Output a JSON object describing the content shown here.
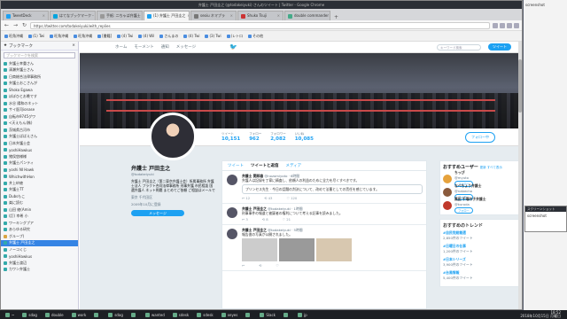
{
  "window": {
    "title": "弁護士 戸田圭之 (@todakeiyuki) さんのツイート | Twitter - Google Chrome"
  },
  "tabs": [
    {
      "label": "TweetDeck",
      "color": "#1da1f2"
    },
    {
      "label": "はてなブックマーク - Ninja",
      "color": "#00a4de"
    },
    {
      "label": "手紙: 二ちゃば弁護士",
      "color": "#999"
    },
    {
      "label": "(1) 弁護士 戸田圭之",
      "color": "#1da1f2",
      "active": true
    },
    {
      "label": "seoiu ネマプラ",
      "color": "#777"
    },
    {
      "label": "Shuko Tsuji",
      "color": "#c33"
    },
    {
      "label": "double commander",
      "color": "#4a8"
    }
  ],
  "bookmarks": [
    "旺角沖縄",
    "(1) Twi",
    "旺角沖縄",
    "旺角沖縄",
    "[書籍]",
    "(4) Twi",
    "(4) Wil",
    "さんまの",
    "(4) Twi",
    "(3) Twi",
    "(レトロ",
    "その他"
  ],
  "address": {
    "url": "https://twitter.com/todakeiyuki/with_replies"
  },
  "sidebar": {
    "title": "ブックマーク",
    "search_placeholder": "ブックマークを検索",
    "items": [
      "弁護士幸重さん",
      "清瀬弁護士さん",
      "日商総合法律事務所",
      "弁護士おこさんが",
      "Shoko Egawa",
      "ぼぼひとお晩です",
      "水谷 陽和のネット",
      "サイ医司ionase",
      "自転市9745グワ",
      "<天えもん(株)",
      "茨城県古河市",
      "弁護士ぱぱえさん",
      "日本弁護士会",
      "yoshiHawkus",
      "猪俣悠様様",
      "弁護士パンティ",
      "yoshi NI Hawk",
      "WhichwithHon",
      "井上紗綾",
      "弁護士TT",
      "Dubsもこ",
      "楽に読む",
      "山田 綾(Amin",
      "(訂) 幸希 小",
      "ワーキングプア",
      "あらゆる研究",
      "グループ(",
      "弁護士 戸田圭之",
      "ノーコくじ",
      "yoshiHawkus",
      "弁護士渡辺",
      "カワン弁護士"
    ],
    "selected_index": 27
  },
  "twitter_nav": {
    "items": [
      "ホーム",
      "モーメント",
      "通知",
      "メッセージ"
    ],
    "search_placeholder": "キーワード検索",
    "tweet_label": "ツイート"
  },
  "profile": {
    "name": "弁護士 戸田圭之",
    "handle": "@todakeiyuki",
    "bio": "弁護士 戸田圭之（第二東京弁護士会）所属事務所 弁護士法人 プラクト合同法律事務所 刑事弁護 市民相談 国選弁護人 ネット問題 まとめてご依頼 ご相談はメールで",
    "location": "東京 千代田区",
    "joined": "2009年10月に登録",
    "message_label": "メッセージ"
  },
  "stats": [
    {
      "label": "ツイート",
      "value": "10,151"
    },
    {
      "label": "フォロー",
      "value": "962"
    },
    {
      "label": "フォロワー",
      "value": "2,082"
    },
    {
      "label": "いいね",
      "value": "10,085"
    }
  ],
  "follow_label": "フォロー中",
  "timeline_tabs": [
    "ツイート",
    "ツイートと返信",
    "メディア"
  ],
  "tweets": [
    {
      "name": "弁護士 関邦雄",
      "meta": "@nozomiyoto · 6時間",
      "text": "弁護人は記録を丁寧に精査し、依頼人の利益のために全力を尽くすべきです。",
      "quote": "プリンセス先生 · 今日の話題の判決について、改めて法曹としての責任を感じています。",
      "actions": [
        "12",
        "43",
        "120"
      ]
    },
    {
      "name": "弁護士 戸田圭之",
      "meta": "@todakeiyuki · 1時間",
      "text": "刑事事件の報道と被疑者の権利について考える記事を読みました。",
      "actions": [
        "3",
        "8",
        "21"
      ]
    },
    {
      "name": "弁護士 戸田圭之",
      "meta": "@todakeiyuki · 5時間",
      "text": "報告書の写真が公開されました。",
      "actions": [
        "",
        "",
        ""
      ]
    }
  ],
  "suggestions": {
    "title": "おすすめユーザー",
    "refresh": "更新 すべて表示",
    "users": [
      {
        "name": "ちっぴ",
        "handle": "@myuto",
        "color": "#e6a23c"
      },
      {
        "name": "なべちょう弁護士",
        "handle": "@nabecho",
        "color": "#8a5a3c"
      },
      {
        "name": "黒田 千瑠の子弁護士",
        "handle": "@kuroda",
        "color": "#c0392b"
      }
    ],
    "follow_label": "フォロー"
  },
  "trends": {
    "title": "おすすめのトレンド",
    "items": [
      {
        "tag": "#自民党総裁選",
        "count": "2,850件のツイート"
      },
      {
        "tag": "#日曜日の仕事",
        "count": "1,200件のツイート"
      },
      {
        "tag": "#日本シリーズ",
        "count": "3,900件のツイート"
      },
      {
        "tag": "#台風情報",
        "count": "5,400件のツイート"
      }
    ]
  },
  "desktop": {
    "label": "screenshot",
    "popup_title": "スクリーンショット",
    "popup_text": "screenshot"
  },
  "taskbar": {
    "items": [
      "~",
      "sdag",
      "double",
      "work",
      "",
      "sdag",
      "",
      "wanted",
      "sdesk",
      "sdesk",
      "xeyes",
      "",
      "Slack",
      "",
      "jp"
    ],
    "clock_time": "18:52",
    "clock_date": "2018年10月15日 月曜日"
  }
}
